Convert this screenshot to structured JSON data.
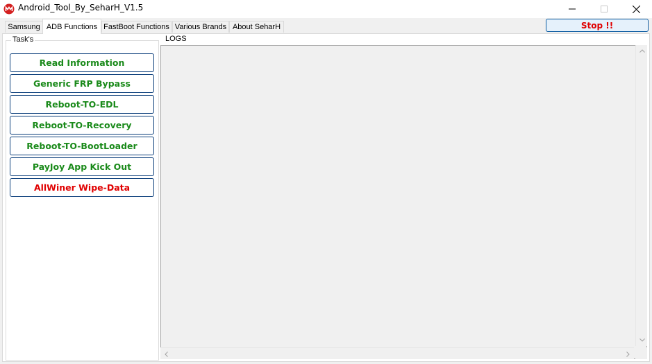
{
  "window": {
    "title": "Android_Tool_By_SeharH_V1.5"
  },
  "tabs": [
    {
      "label": "Samsung"
    },
    {
      "label": "ADB Functions"
    },
    {
      "label": "FastBoot Functions"
    },
    {
      "label": "Various Brands"
    },
    {
      "label": "About SeharH"
    }
  ],
  "active_tab": "ADB Functions",
  "stop_button": {
    "label": "Stop !!"
  },
  "tasks": {
    "legend": "Task's",
    "buttons": [
      {
        "label": "Read Information"
      },
      {
        "label": "Generic FRP Bypass"
      },
      {
        "label": "Reboot-TO-EDL"
      },
      {
        "label": "Reboot-TO-Recovery"
      },
      {
        "label": "Reboot-TO-BootLoader"
      },
      {
        "label": "PayJoy App Kick Out"
      },
      {
        "label": "AllWiner Wipe-Data"
      }
    ]
  },
  "logs": {
    "legend": "LOGS",
    "content": ""
  },
  "colors": {
    "task_text_green": "#1a8a1a",
    "danger_red": "#e00000",
    "button_border": "#0a3d7a",
    "app_icon_red": "#d42020"
  },
  "icons": {
    "app": "app-logo-icon",
    "minimize": "minimize-icon",
    "maximize": "maximize-icon",
    "close": "close-icon"
  }
}
